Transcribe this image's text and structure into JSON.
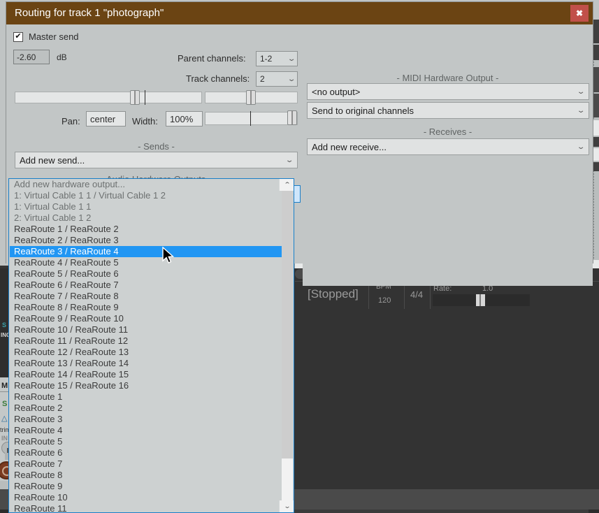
{
  "dialog": {
    "title": "Routing for track 1 \"photograph\"",
    "close_label": "✖",
    "master_send": {
      "label": "Master send",
      "checked_mark": "✔"
    },
    "volume": {
      "value": "-2.60",
      "unit": "dB"
    },
    "parent_channels": {
      "label": "Parent channels:",
      "value": "1-2"
    },
    "track_channels": {
      "label": "Track channels:",
      "value": "2"
    },
    "pan": {
      "label": "Pan:",
      "value": "center"
    },
    "width": {
      "label": "Width:",
      "value": "100%"
    },
    "sends": {
      "header": "-  Sends  -",
      "add_label": "Add new send..."
    },
    "audio_hardware_outputs": {
      "header": "-  Audio Hardware Outputs  -",
      "selected": "Add new hardware output...",
      "options": [
        "Add new hardware output...",
        "1: Virtual Cable 1 1 / Virtual Cable 1 2",
        "1: Virtual Cable 1 1",
        "2: Virtual Cable 1 2",
        "ReaRoute 1 / ReaRoute 2",
        "ReaRoute 2 / ReaRoute 3",
        "ReaRoute 3 / ReaRoute 4",
        "ReaRoute 4 / ReaRoute 5",
        "ReaRoute 5 / ReaRoute 6",
        "ReaRoute 6 / ReaRoute 7",
        "ReaRoute 7 / ReaRoute 8",
        "ReaRoute 8 / ReaRoute 9",
        "ReaRoute 9 / ReaRoute 10",
        "ReaRoute 10 / ReaRoute 11",
        "ReaRoute 11 / ReaRoute 12",
        "ReaRoute 12 / ReaRoute 13",
        "ReaRoute 13 / ReaRoute 14",
        "ReaRoute 14 / ReaRoute 15",
        "ReaRoute 15 / ReaRoute 16",
        "ReaRoute 1",
        "ReaRoute 2",
        "ReaRoute 3",
        "ReaRoute 4",
        "ReaRoute 5",
        "ReaRoute 6",
        "ReaRoute 7",
        "ReaRoute 8",
        "ReaRoute 9",
        "ReaRoute 10",
        "ReaRoute 11"
      ],
      "highlighted_index": 6,
      "highlight_color": "#2196f3"
    },
    "midi_hardware_output": {
      "header": "-  MIDI Hardware Output  -",
      "output": "<no output>",
      "channels": "Send to original channels"
    },
    "receives": {
      "header": "-  Receives  -",
      "add_label": "Add new receive..."
    },
    "chevron": "⌄",
    "chevron_up": "⌃"
  },
  "transport": {
    "status": "[Stopped]",
    "bpm_label": "BPM",
    "bpm_value": "120",
    "time_signature": "4/4",
    "rate_label": "Rate:",
    "rate_value": "1.0"
  },
  "track_panel": {
    "mute": "M",
    "solo": "S",
    "trim_label": "trim",
    "input_label": "IN",
    "rec_arm_label": "S",
    "recording_label": "ING"
  },
  "colors": {
    "titlebar": "#6b4413",
    "close": "#c1504a",
    "dialog_bg": "#c2c6c6",
    "accent_blue": "#2196f3",
    "combo_focus": "#cfe6fb"
  }
}
